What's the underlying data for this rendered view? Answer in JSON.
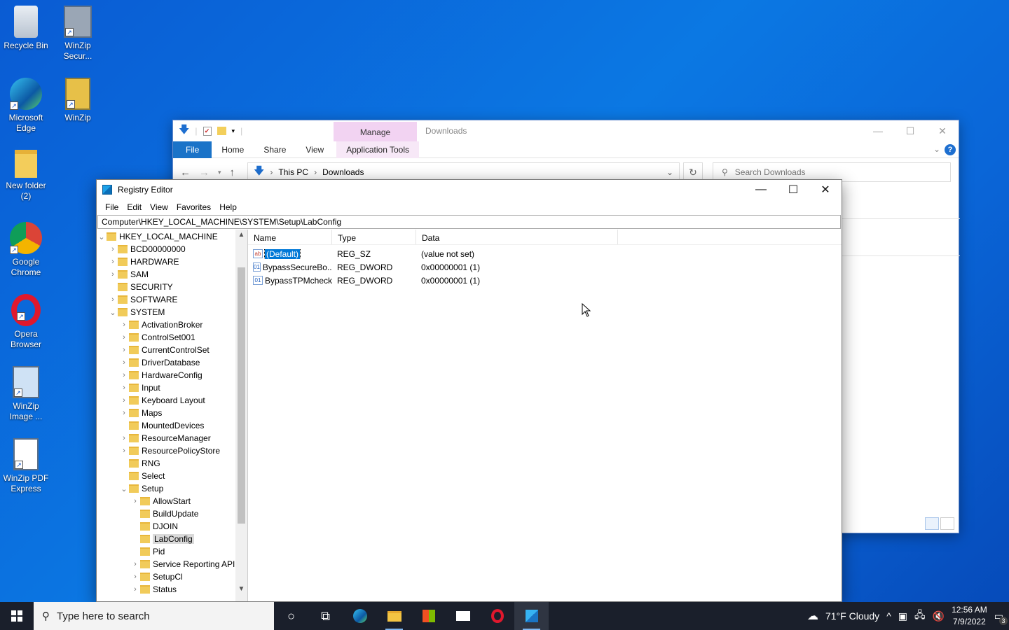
{
  "desktop": {
    "icons": [
      {
        "label": "Recycle Bin",
        "icon": "recycle-bin-icon"
      },
      {
        "label": "WinZip Secur...",
        "icon": "winzip-secure-icon"
      },
      {
        "label": "Microsoft Edge",
        "icon": "edge-icon"
      },
      {
        "label": "WinZip",
        "icon": "winzip-icon"
      },
      {
        "label": "New folder (2)",
        "icon": "folder-icon"
      },
      {
        "label": "Google Chrome",
        "icon": "chrome-icon"
      },
      {
        "label": "Opera Browser",
        "icon": "opera-icon"
      },
      {
        "label": "WinZip Image ...",
        "icon": "winzip-image-icon"
      },
      {
        "label": "WinZip PDF Express",
        "icon": "winzip-pdf-icon"
      }
    ]
  },
  "explorer": {
    "title": "Downloads",
    "manage_label": "Manage",
    "tabs": [
      "File",
      "Home",
      "Share",
      "View",
      "Application Tools"
    ],
    "breadcrumb": [
      "This PC",
      "Downloads"
    ],
    "search_placeholder": "Search Downloads",
    "help": "?"
  },
  "regedit": {
    "title": "Registry Editor",
    "menu": [
      "File",
      "Edit",
      "View",
      "Favorites",
      "Help"
    ],
    "address": "Computer\\HKEY_LOCAL_MACHINE\\SYSTEM\\Setup\\LabConfig",
    "tree": [
      {
        "label": "HKEY_LOCAL_MACHINE",
        "depth": 0,
        "expander": "open"
      },
      {
        "label": "BCD00000000",
        "depth": 1,
        "expander": "closed"
      },
      {
        "label": "HARDWARE",
        "depth": 1,
        "expander": "closed"
      },
      {
        "label": "SAM",
        "depth": 1,
        "expander": "closed"
      },
      {
        "label": "SECURITY",
        "depth": 1,
        "expander": "none"
      },
      {
        "label": "SOFTWARE",
        "depth": 1,
        "expander": "closed"
      },
      {
        "label": "SYSTEM",
        "depth": 1,
        "expander": "open"
      },
      {
        "label": "ActivationBroker",
        "depth": 2,
        "expander": "closed"
      },
      {
        "label": "ControlSet001",
        "depth": 2,
        "expander": "closed"
      },
      {
        "label": "CurrentControlSet",
        "depth": 2,
        "expander": "closed"
      },
      {
        "label": "DriverDatabase",
        "depth": 2,
        "expander": "closed"
      },
      {
        "label": "HardwareConfig",
        "depth": 2,
        "expander": "closed"
      },
      {
        "label": "Input",
        "depth": 2,
        "expander": "closed"
      },
      {
        "label": "Keyboard Layout",
        "depth": 2,
        "expander": "closed"
      },
      {
        "label": "Maps",
        "depth": 2,
        "expander": "closed"
      },
      {
        "label": "MountedDevices",
        "depth": 2,
        "expander": "none"
      },
      {
        "label": "ResourceManager",
        "depth": 2,
        "expander": "closed"
      },
      {
        "label": "ResourcePolicyStore",
        "depth": 2,
        "expander": "closed"
      },
      {
        "label": "RNG",
        "depth": 2,
        "expander": "none"
      },
      {
        "label": "Select",
        "depth": 2,
        "expander": "none"
      },
      {
        "label": "Setup",
        "depth": 2,
        "expander": "open"
      },
      {
        "label": "AllowStart",
        "depth": 3,
        "expander": "closed"
      },
      {
        "label": "BuildUpdate",
        "depth": 3,
        "expander": "none"
      },
      {
        "label": "DJOIN",
        "depth": 3,
        "expander": "none"
      },
      {
        "label": "LabConfig",
        "depth": 3,
        "expander": "none",
        "selected": true
      },
      {
        "label": "Pid",
        "depth": 3,
        "expander": "none"
      },
      {
        "label": "Service Reporting API",
        "depth": 3,
        "expander": "closed"
      },
      {
        "label": "SetupCl",
        "depth": 3,
        "expander": "closed"
      },
      {
        "label": "Status",
        "depth": 3,
        "expander": "closed"
      }
    ],
    "columns": [
      "Name",
      "Type",
      "Data"
    ],
    "values": [
      {
        "name": "(Default)",
        "type": "REG_SZ",
        "data": "(value not set)",
        "icon": "ab",
        "selected": true
      },
      {
        "name": "BypassSecureBo...",
        "type": "REG_DWORD",
        "data": "0x00000001 (1)",
        "icon": "bin"
      },
      {
        "name": "BypassTPMcheck",
        "type": "REG_DWORD",
        "data": "0x00000001 (1)",
        "icon": "bin"
      }
    ]
  },
  "taskbar": {
    "search_placeholder": "Type here to search",
    "weather": "71°F  Cloudy",
    "time": "12:56 AM",
    "date": "7/9/2022",
    "notifications": "3",
    "accent": "#7fb7f0"
  }
}
